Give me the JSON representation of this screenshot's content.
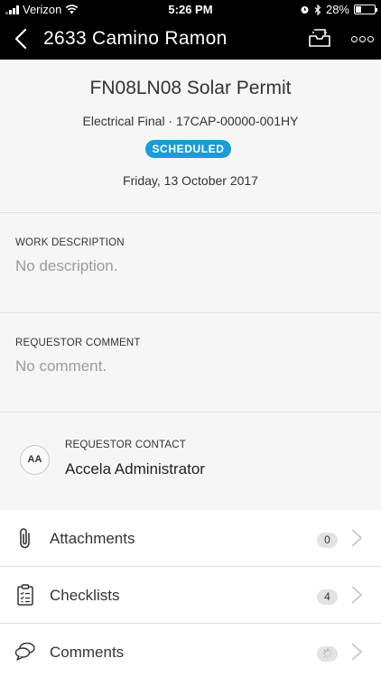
{
  "status_bar": {
    "carrier": "Verizon",
    "time": "5:26 PM",
    "battery_percent": "28%",
    "battery_level": 0.28,
    "icons": [
      "signal-icon",
      "wifi-icon",
      "alarm-icon",
      "bluetooth-icon",
      "battery-icon"
    ]
  },
  "nav": {
    "title": "2633 Camino Ramon",
    "icons": [
      "back-chevron-icon",
      "inbox-tray-icon",
      "more-options-icon"
    ]
  },
  "record": {
    "title": "FN08LN08 Solar Permit",
    "subtitle": "Electrical Final · 17CAP-00000-001HY",
    "status": "SCHEDULED",
    "status_color": "#1a9cd5",
    "date": "Friday, 13 October 2017"
  },
  "work_description": {
    "label": "WORK DESCRIPTION",
    "value": "No description."
  },
  "requestor_comment": {
    "label": "REQUESTOR COMMENT",
    "value": "No comment."
  },
  "requestor_contact": {
    "label": "REQUESTOR CONTACT",
    "initials": "AA",
    "name": "Accela Administrator"
  },
  "list": [
    {
      "label": "Attachments",
      "count": "0",
      "icon": "paperclip-icon"
    },
    {
      "label": "Checklists",
      "count": "4",
      "icon": "clipboard-checklist-icon"
    },
    {
      "label": "Comments",
      "count": "",
      "loading": true,
      "icon": "speech-bubbles-icon"
    }
  ]
}
